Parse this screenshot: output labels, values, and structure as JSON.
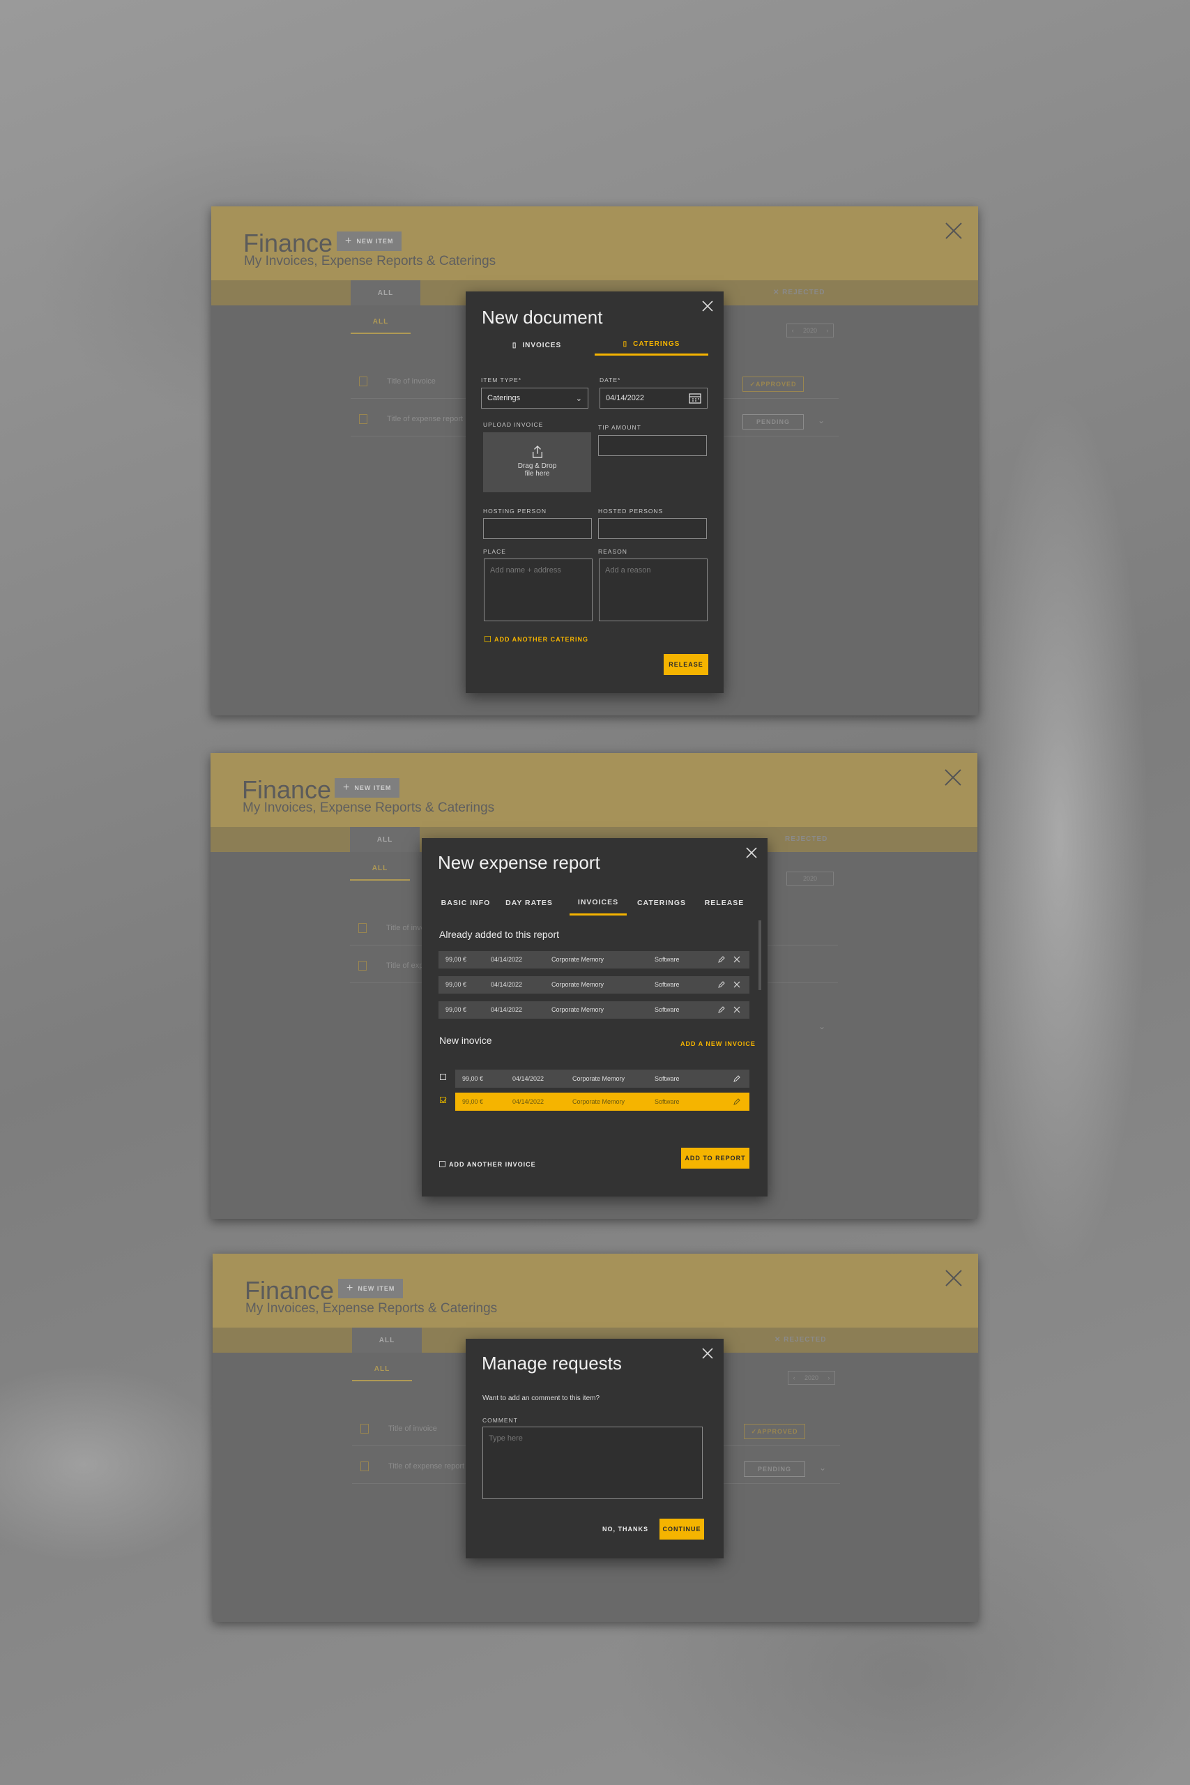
{
  "app": {
    "title": "Finance",
    "subtitle": "My Invoices, Expense Reports & Caterings",
    "new_item_label": "NEW ITEM",
    "tab_all": "ALL",
    "tab_rejected": "REJECTED",
    "subtab_all": "ALL",
    "year": "2020",
    "rows": [
      {
        "title": "Title of invoice",
        "status": "APPROVED"
      },
      {
        "title": "Title of expense report",
        "status": "PENDING"
      }
    ]
  },
  "new_document": {
    "title": "New document",
    "tabs": [
      "INVOICES",
      "CATERINGS"
    ],
    "active_tab": "CATERINGS",
    "item_type_label": "ITEM TYPE*",
    "item_type_value": "Caterings",
    "date_label": "DATE*",
    "date_value": "04/14/2022",
    "upload_label": "UPLOAD INVOICE",
    "drop_text_1": "Drag & Drop",
    "drop_text_2": "file here",
    "tip_label": "TIP AMOUNT",
    "hosting_label": "HOSTING PERSON",
    "hosted_label": "HOSTED PERSONS",
    "place_label": "PLACE",
    "place_placeholder": "Add name + address",
    "reason_label": "REASON",
    "reason_placeholder": "Add a reason",
    "add_another": "ADD ANOTHER CATERING",
    "release_button": "RELEASE"
  },
  "expense_report": {
    "title": "New expense report",
    "tabs": [
      "BASIC INFO",
      "DAY RATES",
      "INVOICES",
      "CATERINGS",
      "RELEASE"
    ],
    "active_tab": "INVOICES",
    "already_added_title": "Already added to this report",
    "added_rows": [
      {
        "amount": "99,00 €",
        "date": "04/14/2022",
        "vendor": "Corporate Memory",
        "category": "Software"
      },
      {
        "amount": "99,00 €",
        "date": "04/14/2022",
        "vendor": "Corporate Memory",
        "category": "Software"
      },
      {
        "amount": "99,00 €",
        "date": "04/14/2022",
        "vendor": "Corporate Memory",
        "category": "Software"
      }
    ],
    "new_invoice_title": "New inovice",
    "add_new_invoice": "ADD A NEW INVOICE",
    "new_rows": [
      {
        "amount": "99,00 €",
        "date": "04/14/2022",
        "vendor": "Corporate Memory",
        "category": "Software",
        "selected": false
      },
      {
        "amount": "99,00 €",
        "date": "04/14/2022",
        "vendor": "Corporate Memory",
        "category": "Software",
        "selected": true
      }
    ],
    "add_another": "ADD ANOTHER INVOICE",
    "add_to_report": "ADD TO REPORT"
  },
  "manage_requests": {
    "title": "Manage requests",
    "question": "Want to add an comment to this item?",
    "comment_label": "COMMENT",
    "comment_placeholder": "Type here",
    "no_button": "NO, THANKS",
    "continue_button": "CONTINUE"
  },
  "colors": {
    "accent": "#f5b400",
    "header": "#a69259",
    "modal_bg": "#333333"
  }
}
